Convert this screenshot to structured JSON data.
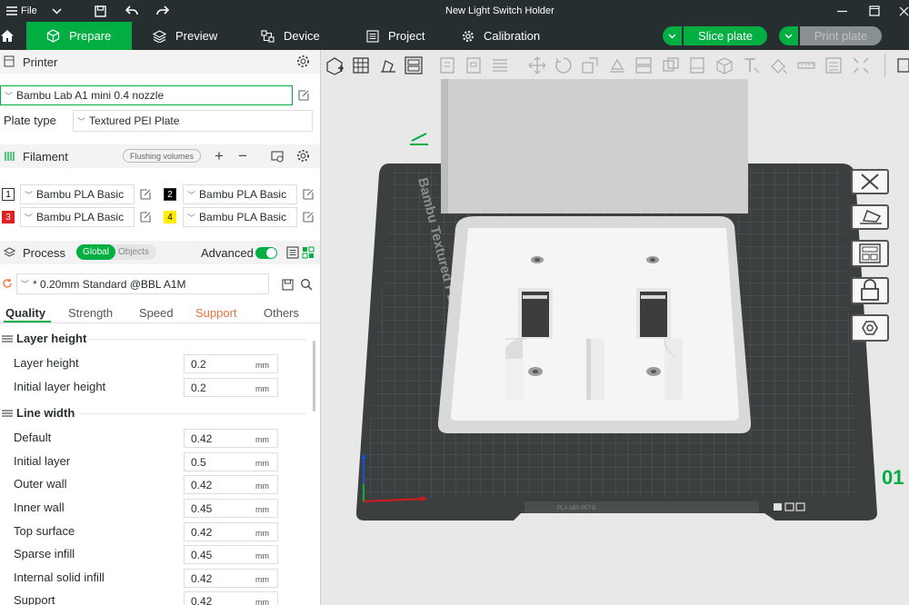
{
  "titlebar": {
    "menu_label": "File",
    "title": "New Light Switch Holder"
  },
  "tabs": [
    {
      "label": "Prepare",
      "active": true
    },
    {
      "label": "Preview",
      "active": false
    },
    {
      "label": "Device",
      "active": false
    },
    {
      "label": "Project",
      "active": false
    },
    {
      "label": "Calibration",
      "active": false
    }
  ],
  "actions": {
    "slice": "Slice plate",
    "print": "Print plate"
  },
  "printer": {
    "header": "Printer",
    "name": "Bambu Lab A1 mini 0.4 nozzle",
    "plate_label": "Plate type",
    "plate_value": "Textured PEI Plate"
  },
  "filament": {
    "header": "Filament",
    "flushing": "Flushing volumes",
    "items": [
      {
        "index": "1",
        "name": "Bambu PLA Basic",
        "color": "#ffffff"
      },
      {
        "index": "2",
        "name": "Bambu PLA Basic",
        "color": "#000000"
      },
      {
        "index": "3",
        "name": "Bambu PLA Basic",
        "color": "#e02020"
      },
      {
        "index": "4",
        "name": "Bambu PLA Basic",
        "color": "#ffee00"
      }
    ]
  },
  "process": {
    "header": "Process",
    "toggle_global": "Global",
    "toggle_objects": "Objects",
    "advanced": "Advanced",
    "preset": "* 0.20mm Standard @BBL A1M",
    "tabs": [
      "Quality",
      "Strength",
      "Speed",
      "Support",
      "Others"
    ]
  },
  "quality": {
    "group1": "Layer height",
    "layer_rows": [
      {
        "label": "Layer height",
        "value": "0.2",
        "unit": "mm"
      },
      {
        "label": "Initial layer height",
        "value": "0.2",
        "unit": "mm"
      }
    ],
    "group2": "Line width",
    "width_rows": [
      {
        "label": "Default",
        "value": "0.42",
        "unit": "mm"
      },
      {
        "label": "Initial layer",
        "value": "0.5",
        "unit": "mm"
      },
      {
        "label": "Outer wall",
        "value": "0.42",
        "unit": "mm"
      },
      {
        "label": "Inner wall",
        "value": "0.45",
        "unit": "mm"
      },
      {
        "label": "Top surface",
        "value": "0.42",
        "unit": "mm"
      },
      {
        "label": "Sparse infill",
        "value": "0.45",
        "unit": "mm"
      },
      {
        "label": "Internal solid infill",
        "value": "0.42",
        "unit": "mm"
      },
      {
        "label": "Support",
        "value": "0.42",
        "unit": "mm"
      }
    ]
  },
  "plate": {
    "label": "Bambu Textured PEI Plate",
    "number": "01",
    "bottom_info": "PLA ABS PETG"
  },
  "colors": {
    "accent": "#00ae42",
    "dark": "#262e30",
    "support_tab": "#e8743b"
  }
}
